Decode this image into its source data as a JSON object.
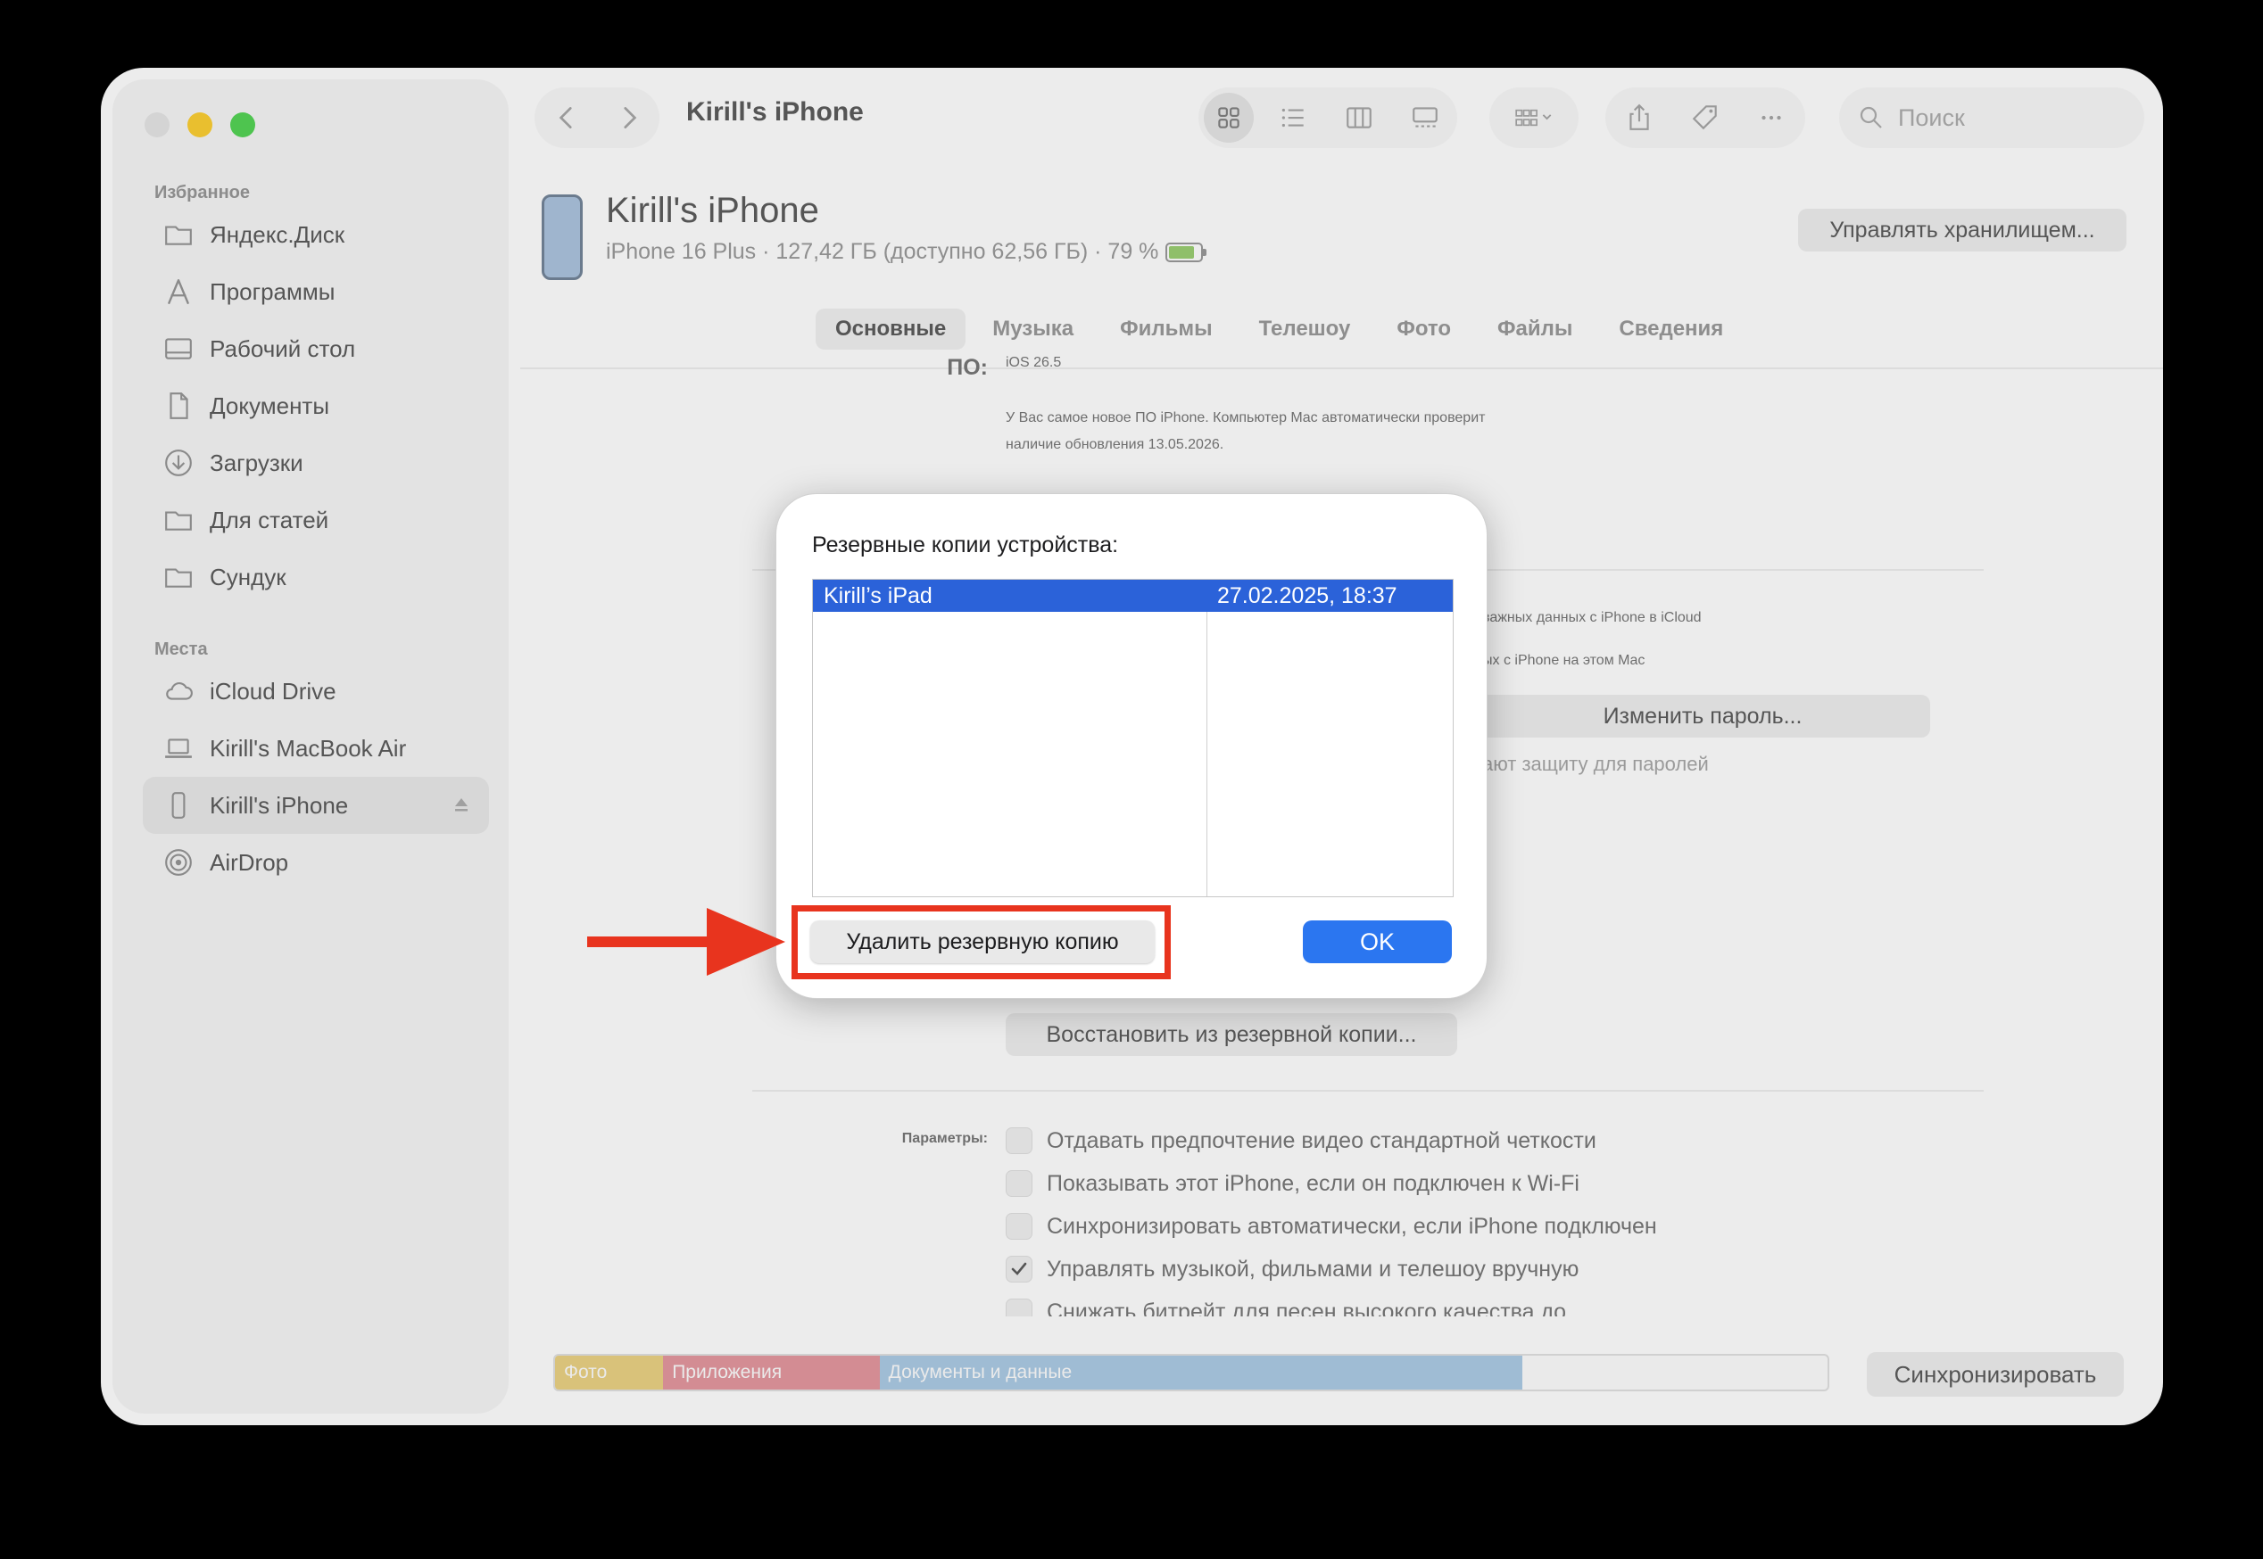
{
  "window": {
    "title": "Kirill's iPhone",
    "search_placeholder": "Поиск"
  },
  "sidebar": {
    "favorites_title": "Избранное",
    "favorites": [
      {
        "label": "Яндекс.Диск",
        "icon": "folder-icon"
      },
      {
        "label": "Программы",
        "icon": "apps-icon"
      },
      {
        "label": "Рабочий стол",
        "icon": "desktop-icon"
      },
      {
        "label": "Документы",
        "icon": "document-icon"
      },
      {
        "label": "Загрузки",
        "icon": "download-icon"
      },
      {
        "label": "Для статей",
        "icon": "folder-icon"
      },
      {
        "label": "Сундук",
        "icon": "folder-icon"
      }
    ],
    "places_title": "Места",
    "places": [
      {
        "label": "iCloud Drive",
        "icon": "cloud-icon"
      },
      {
        "label": "Kirill's MacBook Air",
        "icon": "laptop-icon"
      },
      {
        "label": "Kirill's iPhone",
        "icon": "iphone-icon",
        "selected": true
      },
      {
        "label": "AirDrop",
        "icon": "airdrop-icon"
      }
    ]
  },
  "device": {
    "name": "Kirill's iPhone",
    "info": "iPhone 16 Plus · 127,42 ГБ (доступно 62,56 ГБ) · 79 %",
    "manage_storage": "Управлять хранилищем..."
  },
  "tabs": [
    "Основные",
    "Музыка",
    "Фильмы",
    "Телешоу",
    "Фото",
    "Файлы",
    "Сведения"
  ],
  "general": {
    "software_label": "ПО:",
    "software_version": "iOS 26.5",
    "software_note_1": "У Вас самое новое ПО iPhone. Компьютер Mac автоматически проверит",
    "software_note_2": "наличие обновления 13.05.2026.",
    "backup_partial_1": "важных данных с iPhone в iCloud",
    "backup_partial_2": "ых с iPhone на этом Mac",
    "change_password": "Изменить пароль...",
    "password_note_partial": "ают защиту для паролей",
    "restore_button": "Восстановить из резервной копии...",
    "params_label": "Параметры:",
    "options": [
      {
        "label": "Отдавать предпочтение видео стандартной четкости",
        "checked": false
      },
      {
        "label": "Показывать этот iPhone, если он подключен к Wi-Fi",
        "checked": false
      },
      {
        "label": "Синхронизировать автоматически, если iPhone подключен",
        "checked": false
      },
      {
        "label": "Управлять музыкой, фильмами и телешоу вручную",
        "checked": true
      },
      {
        "label": "Снижать битрейт для песен высокого качества до",
        "checked": false
      }
    ]
  },
  "storage": {
    "segments": [
      {
        "label": "Фото",
        "fraction": 0.085,
        "color": "#d9c27a"
      },
      {
        "label": "Приложения",
        "fraction": 0.17,
        "color": "#d38c93"
      },
      {
        "label": "Документы и данные",
        "fraction": 0.505,
        "color": "#9fbcd4"
      }
    ],
    "sync_button": "Синхронизировать"
  },
  "modal": {
    "title": "Резервные копии устройства:",
    "rows": [
      {
        "name": "Kirill’s iPad",
        "date": "27.02.2025, 18:37"
      }
    ],
    "delete_button": "Удалить резервную копию",
    "ok_button": "OK"
  },
  "colors": {
    "accent": "#2b76f0",
    "selection": "#2b62d9",
    "annotation": "#e8341e"
  }
}
